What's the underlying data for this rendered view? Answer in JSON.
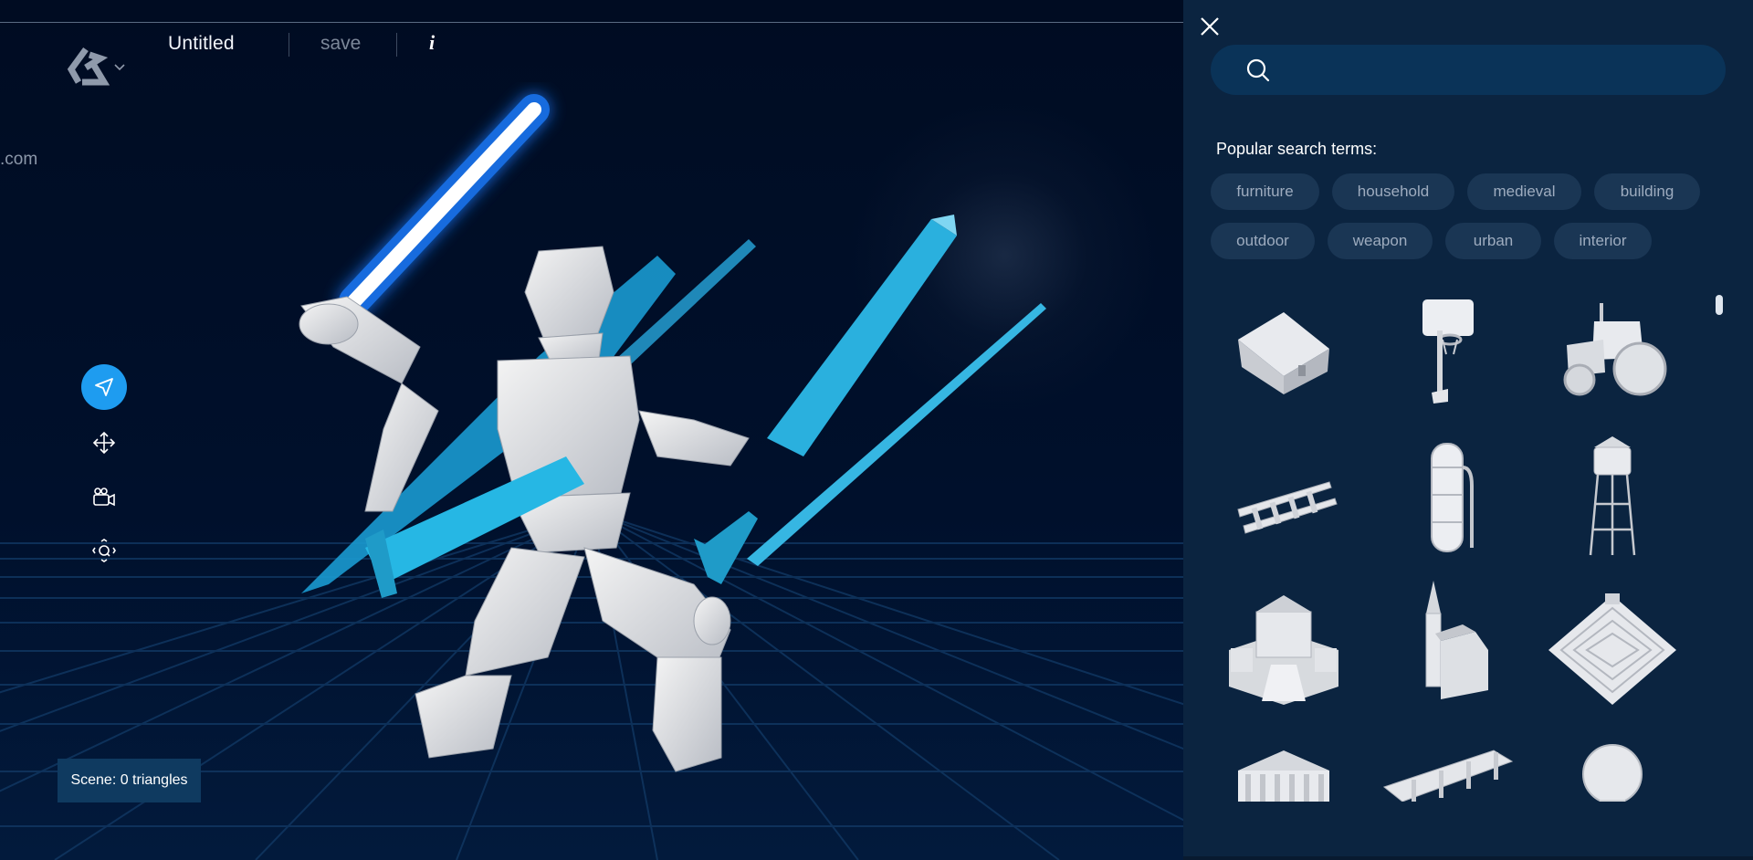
{
  "app": {
    "title": "Untitled",
    "save_label": "save",
    "info_label": "i",
    "side_text": ".com",
    "scene_info": "Scene: 0 triangles"
  },
  "tools": [
    {
      "name": "select-tool",
      "icon": "navigation-arrow-icon",
      "active": true
    },
    {
      "name": "move-tool",
      "icon": "move-arrows-icon",
      "active": false
    },
    {
      "name": "camera-tool",
      "icon": "video-camera-icon",
      "active": false
    },
    {
      "name": "zoom-tool",
      "icon": "zoom-focus-icon",
      "active": false
    }
  ],
  "panel": {
    "search_placeholder": "",
    "popular_label": "Popular search terms:",
    "chips": [
      "furniture",
      "household",
      "medieval",
      "building",
      "outdoor",
      "weapon",
      "urban",
      "interior"
    ],
    "results": [
      "barn",
      "basketball-hoop",
      "tractor",
      "rail-track",
      "tank-tower",
      "water-tower",
      "castle",
      "church",
      "pyramid",
      "temple",
      "pier",
      "sphere"
    ]
  },
  "colors": {
    "accent": "#1e9cf0",
    "panel_bg": "#0b2440",
    "viewport_bg": "#000d24",
    "chip_bg": "#1a3654",
    "sword": "#2bb6e0"
  }
}
